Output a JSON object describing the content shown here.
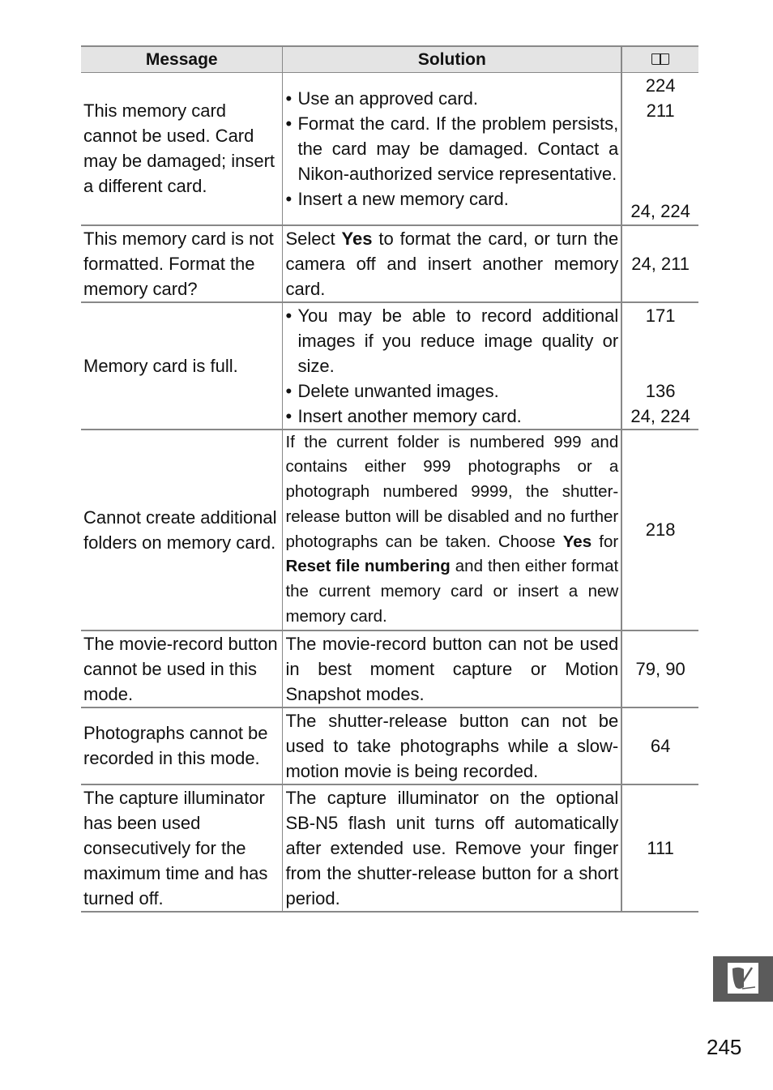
{
  "table": {
    "headers": {
      "message": "Message",
      "solution": "Solution",
      "ref_icon": "book-icon"
    },
    "rows": [
      {
        "message": "This memory card cannot be used. Card may be damaged; insert a different card.",
        "solutions": [
          {
            "text": "Use an approved card.",
            "ref": "224"
          },
          {
            "text": "Format the card. If the problem persists, the card may be damaged. Contact a Nikon-authorized service representative.",
            "ref": "211"
          },
          {
            "text": "Insert a new memory card.",
            "ref": "24, 224"
          }
        ]
      },
      {
        "message": "This memory card is not formatted. Format the memory card?",
        "solution_pre": "Select ",
        "solution_bold": "Yes",
        "solution_post": " to format the card, or turn the camera off and insert another memory card.",
        "ref": "24, 211"
      },
      {
        "message": "Memory card is full.",
        "solutions": [
          {
            "text": "You may be able to record additional images if you reduce image quality or size.",
            "ref": "171"
          },
          {
            "text": "Delete unwanted images.",
            "ref": "136"
          },
          {
            "text": "Insert another memory card.",
            "ref": "24, 224"
          }
        ]
      },
      {
        "message": "Cannot create additional folders on memory card.",
        "solution_a": "If the current folder is numbered 999 and contains either 999 photographs or a photograph numbered 9999, the shutter-release button will be disabled and no further photographs can be taken. Choose ",
        "solution_b1": "Yes",
        "solution_mid": " for ",
        "solution_b2": "Reset file numbering",
        "solution_c": " and then either format the current memory card or insert a new memory card.",
        "ref": "218"
      },
      {
        "message": "The movie-record button cannot be used in this mode.",
        "solution": "The movie-record button can not be used in best moment capture or Motion Snapshot modes.",
        "ref": "79, 90"
      },
      {
        "message": "Photographs cannot be recorded in this mode.",
        "solution": "The shutter-release button can not be used to take photographs while a slow-motion movie is being recorded.",
        "ref": "64"
      },
      {
        "message": "The capture illuminator has been used consecutively for the maximum time and has turned off.",
        "solution": "The capture illuminator on the optional SB-N5 flash unit turns off automatically after extended use. Remove your finger from the shutter-release button for a short period.",
        "ref": "111"
      }
    ]
  },
  "side_tab": {
    "icon": "troubleshooting-pen-icon"
  },
  "page_number": "245"
}
